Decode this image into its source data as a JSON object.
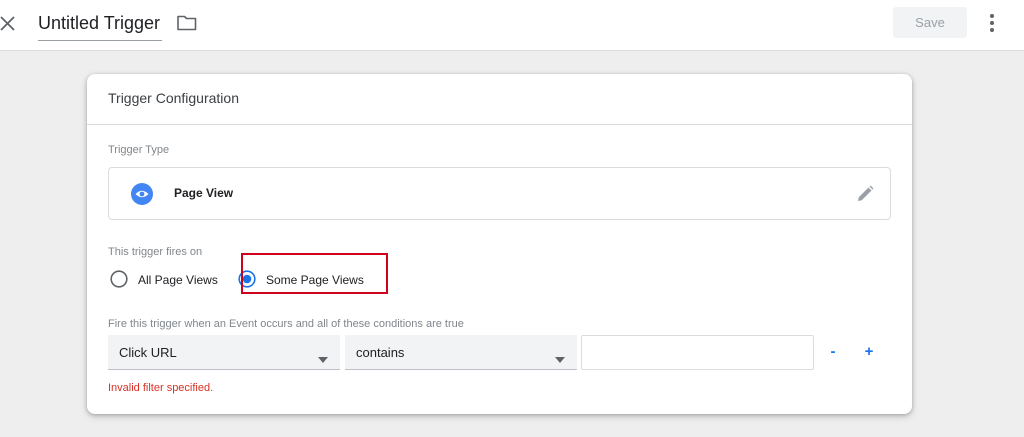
{
  "header": {
    "title": "Untitled Trigger",
    "save_label": "Save",
    "icons": [
      "close-icon",
      "folder-icon",
      "more-vertical-icon"
    ]
  },
  "card": {
    "title": "Trigger Configuration",
    "trigger_type_label": "Trigger Type",
    "trigger_type": {
      "name": "Page View",
      "icon": "eye-icon",
      "edit_icon": "pencil-icon"
    },
    "fires_on_label": "This trigger fires on",
    "fires_on_options": [
      {
        "label": "All Page Views",
        "selected": false
      },
      {
        "label": "Some Page Views",
        "selected": true
      }
    ],
    "conditions_label": "Fire this trigger when an Event occurs and all of these conditions are true",
    "condition": {
      "variable": "Click URL",
      "operator": "contains",
      "value": "",
      "remove_label": "-",
      "add_label": "+"
    },
    "error_text": "Invalid filter specified."
  },
  "colors": {
    "accent": "#1a73e8",
    "error": "#d93025",
    "highlight": "#d0021b",
    "save_disabled_bg": "#f1f3f4"
  }
}
